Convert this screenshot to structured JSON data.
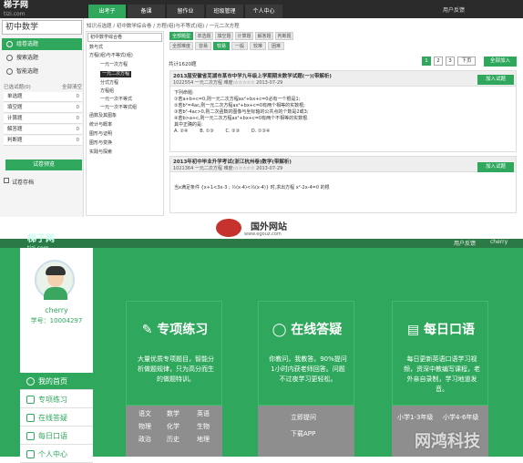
{
  "top": {
    "logo": "梯子网",
    "logo_sub": "tizi.com",
    "nav": [
      "出考子",
      "备课",
      "留作业",
      "班级管理",
      "个人中心"
    ],
    "user_link": "用户反馈",
    "subject": "初中数学",
    "left_menu": [
      "组卷选题",
      "搜索选题",
      "智能选题"
    ],
    "type_header": "已选试题(0)",
    "type_clear": "全部清空",
    "types": [
      {
        "label": "单选题",
        "count": "0"
      },
      {
        "label": "填空题",
        "count": "0"
      },
      {
        "label": "计算题",
        "count": "0"
      },
      {
        "label": "解答题",
        "count": "0"
      },
      {
        "label": "判断题",
        "count": "0"
      }
    ],
    "preview_btn": "试卷预览",
    "archive": "试卷存档",
    "breadcrumb": "知识点选题 / 初中数学综合卷 / 方程(组)与不等式(组) / 一元二次方程",
    "tree_select": "初中数学综合卷",
    "tree": [
      "数与式",
      "方程(组)与不等式(组)",
      "一元一次方程",
      "一元二次方程",
      "分式方程",
      "方程组",
      "一元一次不等式",
      "一元一次不等式组",
      "函数及其图象",
      "统计与概率",
      "图形与证明",
      "图形与变换",
      "实践与探索"
    ],
    "filter_row1": [
      "全部题型",
      "单选题",
      "填空题",
      "计算题",
      "解答题",
      "判断题"
    ],
    "filter_row2": [
      "全部难度",
      "容易",
      "较易",
      "一般",
      "较难",
      "困难"
    ],
    "count_text": "共计1620题",
    "pages": [
      "1",
      "2",
      "3",
      "下页"
    ],
    "add_all": "全部加入",
    "q1": {
      "title": "2013届安徽省芜湖市某市中学九年级上学期期末数学试题(一)(带解析)",
      "meta": "1022554  一元二次方程  难度:☆☆☆☆☆  2013-07-29",
      "add": "加入试题",
      "lines": [
        "下列命题:",
        "①若a+b+c=0,则一元二次方程ax²+bx+c=0必有一个根是1;",
        "②若b²=4ac,则一元二次方程ax²+bx+c=0有两个相等的实数根;",
        "③若b²-4ac>0,则二次函数的图像与坐标轴的公共点的个数是2或3;",
        "④若b>a+c,则一元二次方程ax²+bx+c=0有两个不相等的实数根.",
        "其中正确的是:",
        "A. ②④        B. ①③        C. ②③        D. ①③④"
      ]
    },
    "q2": {
      "title": "2013年初中毕业升学考试(浙江杭州卷)数学(带解析)",
      "meta": "1021364  一元二次方程  难度:☆☆☆☆☆  2013-07-29",
      "add": "加入试题",
      "lines": [
        "当x满足条件 {x+1<3x-3 ; ½(x-4)<⅓(x-4)} 时,求出方程 x²-2x-4=0 的根"
      ]
    }
  },
  "watermark": {
    "title": "国外网站",
    "url": "www.egouz.com"
  },
  "bottom": {
    "logo": "梯子网",
    "logo_sub": "tizi.com",
    "nav": "用户反馈",
    "username": "cherry",
    "profile_name": "cherry",
    "profile_id": "学号：10004297",
    "side_nav": [
      "我的首页",
      "专项练习",
      "在线答疑",
      "每日口语",
      "个人中心"
    ],
    "cards": [
      {
        "title": "专项练习",
        "desc": "大量优质专项题目，智能分析做题规律，只为高分而生的做题特训。",
        "foot": [
          "语文",
          "数学",
          "英语",
          "物理",
          "化学",
          "生物",
          "政治",
          "历史",
          "地理"
        ]
      },
      {
        "title": "在线答疑",
        "desc": "你教问，我教答。90%提问1小时内获老师回答。问题不过夜学习更轻松。",
        "foot": [
          "立即提问",
          "下载APP"
        ]
      },
      {
        "title": "每日口语",
        "desc": "每日更新英语口语学习视频，资深中教编写课程，老外亲自录制，学习地道发音。",
        "foot": [
          "小学1-3年级",
          "小学4-6年级"
        ]
      }
    ],
    "corner_watermark": "网鸿科技"
  }
}
